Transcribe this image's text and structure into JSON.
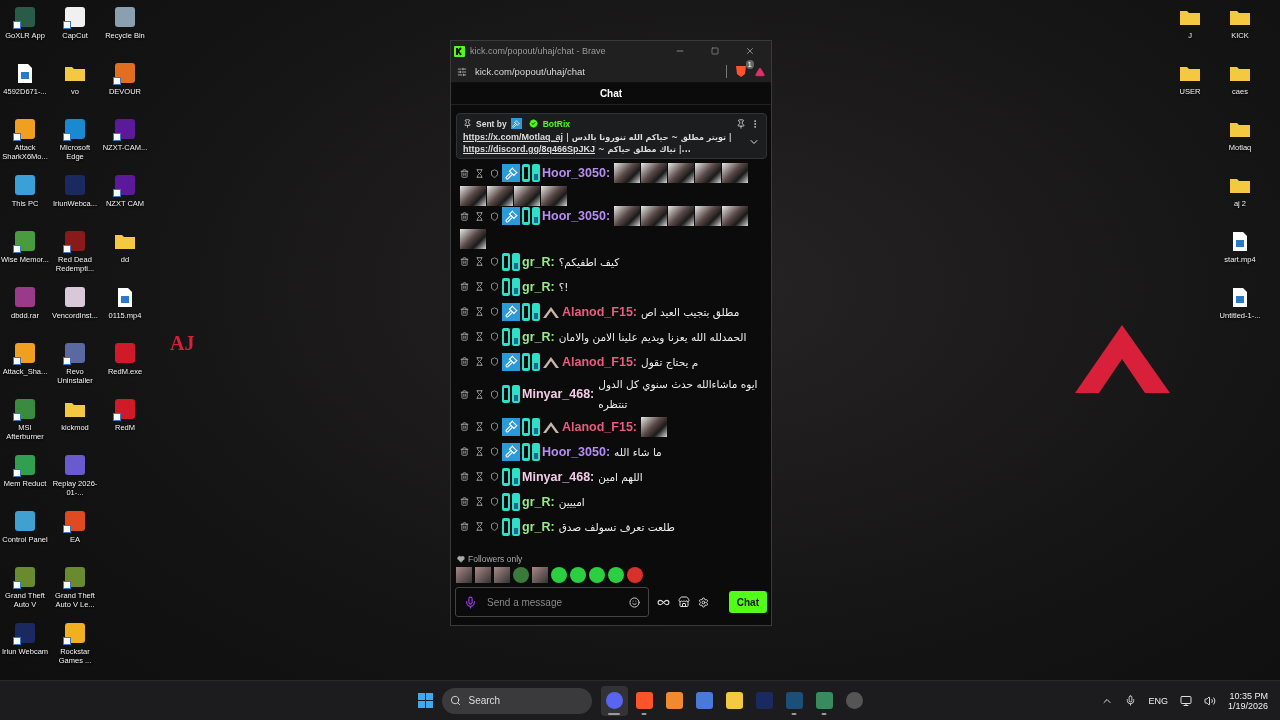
{
  "wallpaper": {
    "mark": "AJ"
  },
  "desktop": {
    "left_columns": [
      [
        {
          "label": "GoXLR App",
          "kind": "app",
          "color": "#2a5a48",
          "shortcut": true
        },
        {
          "label": "4592D671-...",
          "kind": "video",
          "shortcut": false
        },
        {
          "label": "Attack SharkX6Mo...",
          "kind": "app",
          "color": "#f0a020",
          "shortcut": true
        },
        {
          "label": "This PC",
          "kind": "app",
          "color": "#3aa0d8",
          "shortcut": false
        },
        {
          "label": "Wise Memor...",
          "kind": "app",
          "color": "#4a9a40",
          "shortcut": true
        },
        {
          "label": "dbdd.rar",
          "kind": "app",
          "color": "#9a3a8a",
          "shortcut": false
        },
        {
          "label": "Attack_Sha...",
          "kind": "app",
          "color": "#f0a020",
          "shortcut": true
        },
        {
          "label": "MSI Afterburner",
          "kind": "app",
          "color": "#3a8a40",
          "shortcut": true
        },
        {
          "label": "Mem Reduct",
          "kind": "app",
          "color": "#30a050",
          "shortcut": true
        },
        {
          "label": "Control Panel",
          "kind": "app",
          "color": "#40a0d0",
          "shortcut": false
        },
        {
          "label": "Grand Theft Auto V",
          "kind": "app",
          "color": "#6a8a30",
          "shortcut": true
        },
        {
          "label": "Iriun Webcam",
          "kind": "app",
          "color": "#1a2a60",
          "shortcut": true
        }
      ],
      [
        {
          "label": "CapCut",
          "kind": "app",
          "color": "#f0f0f0",
          "shortcut": true
        },
        {
          "label": "vo",
          "kind": "folder",
          "shortcut": false
        },
        {
          "label": "Microsoft Edge",
          "kind": "app",
          "color": "#1a8ad0",
          "shortcut": true
        },
        {
          "label": "IriunWebca...",
          "kind": "app",
          "color": "#1a2a60",
          "shortcut": false
        },
        {
          "label": "Red Dead Redempti...",
          "kind": "app",
          "color": "#8a1a1a",
          "shortcut": true
        },
        {
          "label": "VencordInst...",
          "kind": "app",
          "color": "#d8c8d8",
          "shortcut": false
        },
        {
          "label": "Revo Uninstaller",
          "kind": "app",
          "color": "#5a6aa0",
          "shortcut": true
        },
        {
          "label": "kickmod",
          "kind": "folder",
          "shortcut": false
        },
        {
          "label": "Replay 2026-01-...",
          "kind": "app",
          "color": "#6a5ad0",
          "shortcut": false
        },
        {
          "label": "EA",
          "kind": "app",
          "color": "#e04a20",
          "shortcut": true
        },
        {
          "label": "Grand Theft Auto V Le...",
          "kind": "app",
          "color": "#6a8a30",
          "shortcut": true
        },
        {
          "label": "Rockstar Games ...",
          "kind": "app",
          "color": "#f0b020",
          "shortcut": true
        }
      ],
      [
        {
          "label": "Recycle Bin",
          "kind": "app",
          "color": "#8aa0b0",
          "shortcut": false
        },
        {
          "label": "DEVOUR",
          "kind": "app",
          "color": "#e07020",
          "shortcut": true
        },
        {
          "label": "NZXT-CAM...",
          "kind": "app",
          "color": "#5a1a9a",
          "shortcut": true
        },
        {
          "label": "NZXT CAM",
          "kind": "app",
          "color": "#5a1a9a",
          "shortcut": true
        },
        {
          "label": "dd",
          "kind": "folder",
          "shortcut": false
        },
        {
          "label": "0115.mp4",
          "kind": "video",
          "shortcut": false
        },
        {
          "label": "RedM.exe",
          "kind": "app",
          "color": "#d01a2a",
          "shortcut": false
        },
        {
          "label": "RedM",
          "kind": "app",
          "color": "#d01a2a",
          "shortcut": true
        }
      ]
    ],
    "right_columns": [
      [
        {
          "label": "J",
          "kind": "folder",
          "shortcut": false
        },
        {
          "label": "USER",
          "kind": "folder",
          "shortcut": false
        }
      ],
      [
        {
          "label": "KICK",
          "kind": "folder",
          "shortcut": false
        },
        {
          "label": "caes",
          "kind": "folder",
          "shortcut": false
        },
        {
          "label": "Motlaq",
          "kind": "folder",
          "shortcut": false
        },
        {
          "label": "aj 2",
          "kind": "folder",
          "shortcut": false
        },
        {
          "label": "start.mp4",
          "kind": "video",
          "shortcut": false
        },
        {
          "label": "Untitled-1-...",
          "kind": "video",
          "shortcut": false
        }
      ]
    ]
  },
  "browser_window": {
    "title": "kick.com/popout/uhaj/chat - Brave",
    "address": "kick.com/popout/uhaj/chat",
    "shield_badge": "1"
  },
  "chat": {
    "header": "Chat",
    "pinned": {
      "sent_by": "Sent by",
      "author": "BotRix",
      "lines": [
        [
          {
            "text": "https://x.com/Motlaq_aj",
            "link": true
          },
          {
            "text": "| تويتر مطلق ~ حياكم الله تنورونا بالدس |",
            "link": false
          }
        ],
        [
          {
            "text": "https://discord.gg/8q466SpJKJ",
            "link": true
          },
          {
            "text": "~ تياك مطلق حياكم |...",
            "link": false
          }
        ]
      ]
    },
    "messages": [
      {
        "user": "Hoor_3050:",
        "color": "#b88cf5",
        "badges": [
          {
            "kind": "moderator"
          },
          {
            "kind": "og"
          }
        ],
        "emotes": [
          {
            "kind": "photo"
          },
          {
            "kind": "photo"
          },
          {
            "kind": "photo"
          },
          {
            "kind": "photo"
          },
          {
            "kind": "photo"
          },
          {
            "kind": "photo"
          },
          {
            "kind": "photo"
          },
          {
            "kind": "photo"
          },
          {
            "kind": "photo"
          }
        ]
      },
      {
        "user": "Hoor_3050:",
        "color": "#b88cf5",
        "badges": [
          {
            "kind": "moderator"
          },
          {
            "kind": "og"
          }
        ],
        "emotes": [
          {
            "kind": "photo"
          },
          {
            "kind": "photo"
          },
          {
            "kind": "photo"
          },
          {
            "kind": "photo"
          },
          {
            "kind": "photo"
          },
          {
            "kind": "photo"
          }
        ]
      },
      {
        "user": "gr_R:",
        "color": "#9be88a",
        "badges": [
          {
            "kind": "og"
          }
        ],
        "text": "كيف اطفيكم؟"
      },
      {
        "user": "gr_R:",
        "color": "#9be88a",
        "badges": [
          {
            "kind": "og"
          }
        ],
        "text": "!؟"
      },
      {
        "user": "Alanod_F15:",
        "color": "#ec5a80",
        "badges": [
          {
            "kind": "moderator"
          },
          {
            "kind": "og"
          },
          {
            "kind": "vip"
          }
        ],
        "text": "مطلق بتجيب العيد اص"
      },
      {
        "user": "gr_R:",
        "color": "#9be88a",
        "badges": [
          {
            "kind": "og"
          }
        ],
        "text": "الحمدلله الله يعزنا ويديم علينا الامن والامان"
      },
      {
        "user": "Alanod_F15:",
        "color": "#ec5a80",
        "badges": [
          {
            "kind": "moderator"
          },
          {
            "kind": "og"
          },
          {
            "kind": "vip"
          }
        ],
        "text": "م يحتاج تقول"
      },
      {
        "user": "Minyar_468:",
        "color": "#f2cce4",
        "badges": [
          {
            "kind": "og"
          }
        ],
        "text": "ايوه ماشاءالله حدث سنوي كل الدول تنتظره"
      },
      {
        "user": "Alanod_F15:",
        "color": "#ec5a80",
        "badges": [
          {
            "kind": "moderator"
          },
          {
            "kind": "og"
          },
          {
            "kind": "vip"
          }
        ],
        "emotes": [
          {
            "kind": "photo"
          }
        ]
      },
      {
        "user": "Hoor_3050:",
        "color": "#b88cf5",
        "badges": [
          {
            "kind": "moderator"
          },
          {
            "kind": "og"
          }
        ],
        "text": "ما شاء الله"
      },
      {
        "user": "Minyar_468:",
        "color": "#f2cce4",
        "badges": [
          {
            "kind": "og"
          }
        ],
        "text": "اللهم امين"
      },
      {
        "user": "gr_R:",
        "color": "#9be88a",
        "badges": [
          {
            "kind": "og"
          }
        ],
        "text": "امييين"
      },
      {
        "user": "gr_R:",
        "color": "#9be88a",
        "badges": [
          {
            "kind": "og"
          }
        ],
        "text": "طلعت تعرف تسولف صدق"
      }
    ],
    "mode": "Followers only",
    "quick_emotes": [
      {
        "kind": "photo"
      },
      {
        "kind": "photo"
      },
      {
        "kind": "photo"
      },
      {
        "kind": "frog"
      },
      {
        "kind": "photo"
      },
      {
        "kind": "green-face"
      },
      {
        "kind": "green-face"
      },
      {
        "kind": "green-face"
      },
      {
        "kind": "green-face"
      },
      {
        "kind": "red-face"
      }
    ],
    "input": {
      "placeholder": "Send a message"
    },
    "send_button": "Chat"
  },
  "taskbar": {
    "search": {
      "placeholder": "Search"
    },
    "apps": [
      {
        "kind": "chat",
        "running": true,
        "selected": true
      },
      {
        "kind": "browser",
        "running": true,
        "selected": false
      },
      {
        "kind": "launcher",
        "running": false,
        "selected": false
      },
      {
        "kind": "network",
        "running": false,
        "selected": false
      },
      {
        "kind": "folder",
        "running": false,
        "selected": false
      },
      {
        "kind": "webcam",
        "running": false,
        "selected": false
      },
      {
        "kind": "store",
        "running": true,
        "selected": false
      },
      {
        "kind": "spreadsheet",
        "running": true,
        "selected": false
      },
      {
        "kind": "recorder",
        "running": false,
        "selected": false
      }
    ],
    "language": "ENG",
    "time": "10:35 PM",
    "date": "1/19/2026"
  }
}
